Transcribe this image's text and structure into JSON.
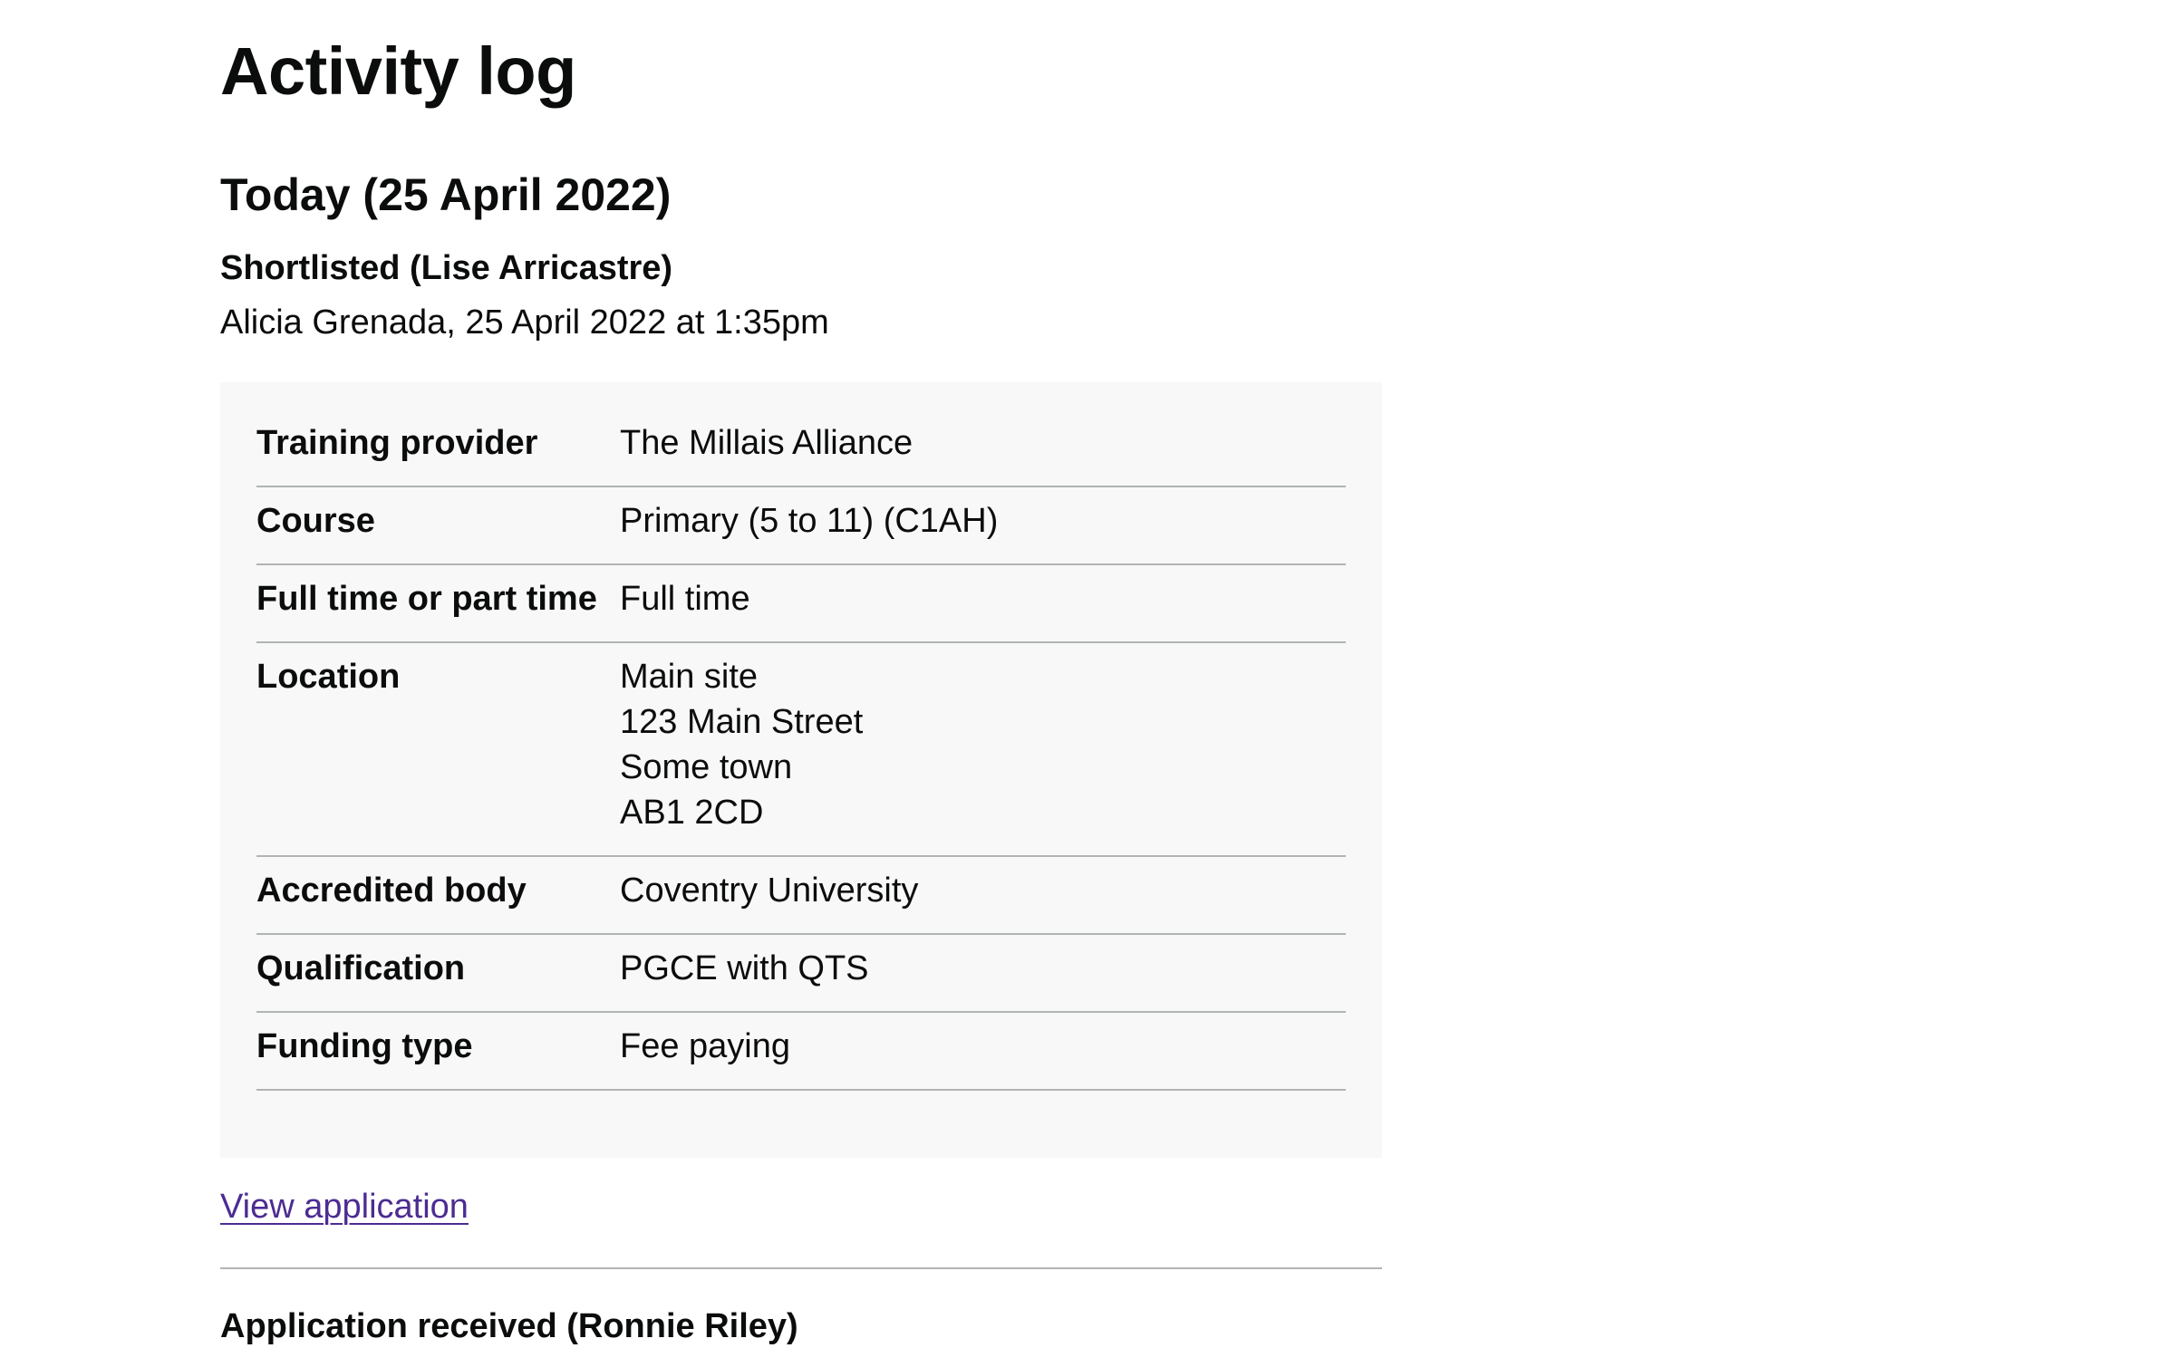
{
  "page": {
    "title": "Activity log"
  },
  "sections": [
    {
      "heading": "Today (25 April 2022)",
      "events": [
        {
          "title": "Shortlisted (Lise Arricastre)",
          "meta": "Alicia Grenada, 25 April 2022 at 1:35pm",
          "summary": {
            "training_provider": {
              "key": "Training provider",
              "value": "The Millais Alliance"
            },
            "course": {
              "key": "Course",
              "value": "Primary (5 to 11) (C1AH)"
            },
            "study_mode": {
              "key": "Full time or part time",
              "value": "Full time"
            },
            "location": {
              "key": "Location",
              "lines": [
                "Main site",
                "123 Main Street",
                "Some town",
                "AB1 2CD"
              ]
            },
            "accredited_body": {
              "key": "Accredited body",
              "value": "Coventry University"
            },
            "qualification": {
              "key": "Qualification",
              "value": "PGCE with QTS"
            },
            "funding_type": {
              "key": "Funding type",
              "value": "Fee paying"
            }
          },
          "link_label": "View application"
        },
        {
          "title": "Application received (Ronnie Riley)"
        }
      ]
    }
  ]
}
